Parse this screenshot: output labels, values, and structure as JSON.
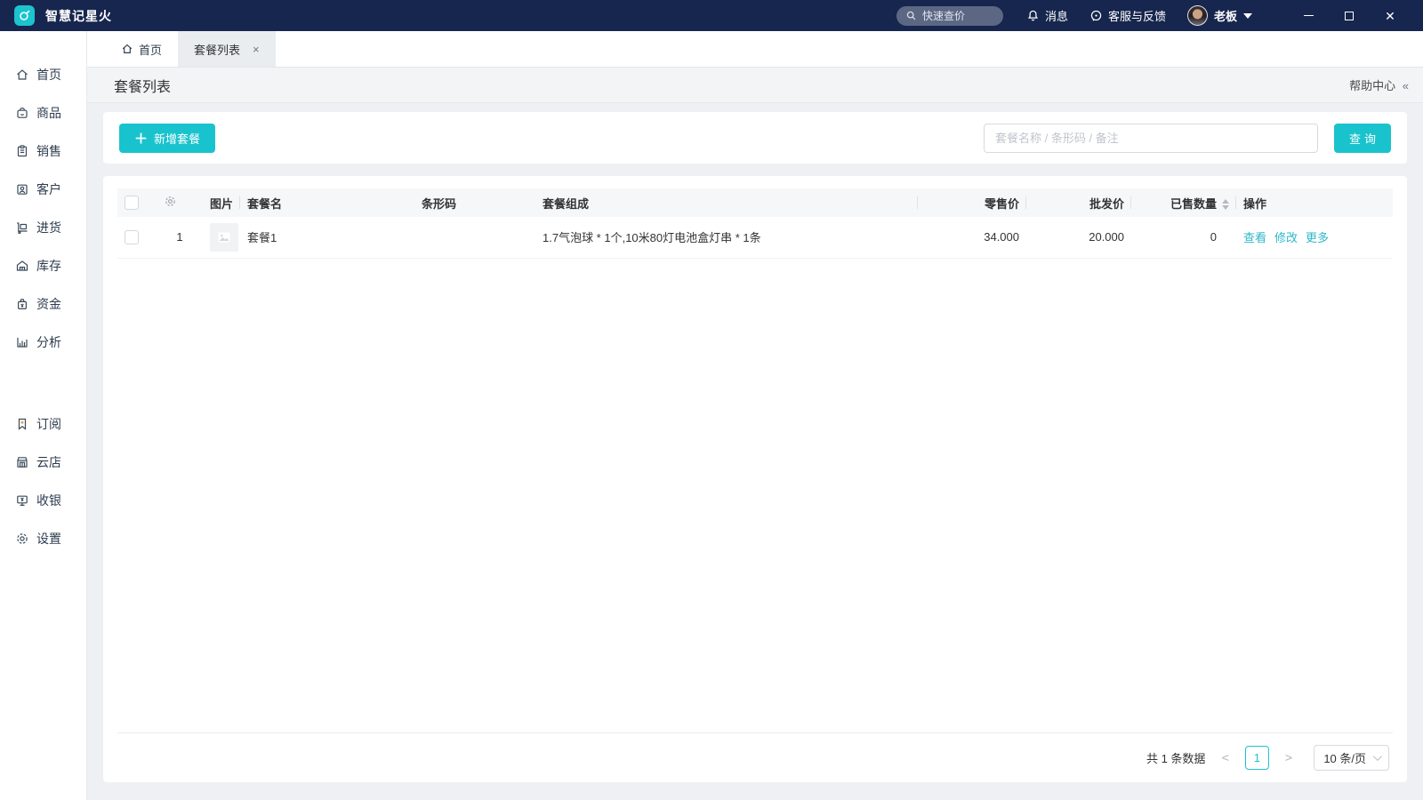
{
  "colors": {
    "titlebar_bg": "#16264e",
    "accent_teal": "#19c3cd",
    "link_teal": "#2db7c8",
    "page_bg": "#eef0f3",
    "table_header_bg": "#f6f7f8"
  },
  "titlebar": {
    "app_name": "智慧记星火",
    "quick_search_placeholder": "快速查价",
    "messages_label": "消息",
    "support_label": "客服与反馈",
    "user_name": "老板"
  },
  "tabs": {
    "home": {
      "label": "首页"
    },
    "active": {
      "label": "套餐列表",
      "close_glyph": "×"
    }
  },
  "sidebar": {
    "main": [
      {
        "label": "首页"
      },
      {
        "label": "商品"
      },
      {
        "label": "销售"
      },
      {
        "label": "客户"
      },
      {
        "label": "进货"
      },
      {
        "label": "库存"
      },
      {
        "label": "资金"
      },
      {
        "label": "分析"
      }
    ],
    "extra": [
      {
        "label": "订阅"
      },
      {
        "label": "云店"
      },
      {
        "label": "收银"
      },
      {
        "label": "设置"
      }
    ]
  },
  "page": {
    "title": "套餐列表",
    "help_label": "帮助中心",
    "collapse_glyph": "«"
  },
  "toolbar": {
    "add_plus_glyph": "＋",
    "add_label": "新增套餐",
    "search_placeholder": "套餐名称 / 条形码 / 备注",
    "query_label": "查询"
  },
  "table": {
    "columns": {
      "image": "图片",
      "name": "套餐名",
      "barcode": "条形码",
      "composition": "套餐组成",
      "retail_price": "零售价",
      "wholesale_price": "批发价",
      "sold_qty": "已售数量",
      "operations": "操作"
    },
    "rows": [
      {
        "index": "1",
        "name": "套餐1",
        "barcode": "",
        "composition": "1.7气泡球 * 1个,10米80灯电池盒灯串 * 1条",
        "retail_price": "34.000",
        "wholesale_price": "20.000",
        "sold_qty": "0",
        "actions": {
          "view": "查看",
          "edit": "修改",
          "more": "更多"
        }
      }
    ]
  },
  "pagination": {
    "total_text": "共 1 条数据",
    "prev_glyph": "<",
    "current_page": "1",
    "next_glyph": ">",
    "page_size_label": "10 条/页"
  },
  "icons": {
    "titlebar": [
      "app-logo-icon",
      "search-icon",
      "bell-icon",
      "headset-icon",
      "avatar",
      "caret-down-icon",
      "minimize-icon",
      "maximize-icon",
      "close-icon"
    ],
    "sidebar": [
      "home-icon",
      "goods-icon",
      "sales-icon",
      "customer-icon",
      "purchase-icon",
      "inventory-icon",
      "funds-icon",
      "analytics-icon",
      "subscribe-icon",
      "cloud-store-icon",
      "cashier-icon",
      "settings-icon"
    ],
    "table": [
      "checkbox",
      "column-settings-gear-icon",
      "sort-icon",
      "image-placeholder-icon"
    ]
  }
}
